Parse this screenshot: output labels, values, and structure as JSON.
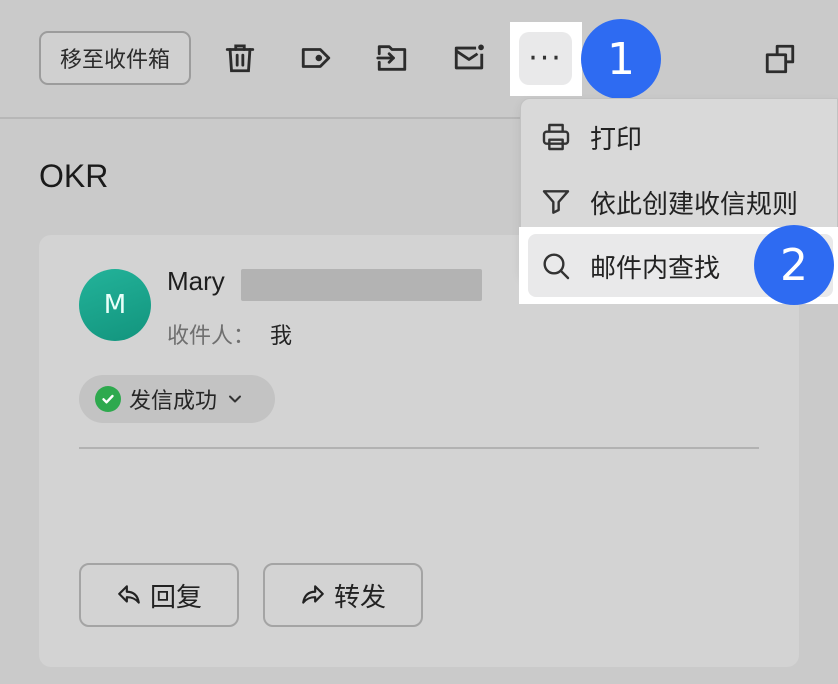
{
  "toolbar": {
    "move_to_inbox_label": "移至收件箱",
    "icons": [
      "trash-icon",
      "tag-icon",
      "move-icon",
      "mail-unread-icon"
    ],
    "more_label": "···",
    "window_icon": "window-icon"
  },
  "annotations": {
    "step1": "1",
    "step2": "2"
  },
  "mail": {
    "subject": "OKR",
    "avatar_letter": "M",
    "sender_name": "Mary",
    "to_label": "收件人：",
    "to_value": "我",
    "status_label": "发信成功"
  },
  "actions": {
    "reply_label": "回复",
    "forward_label": "转发"
  },
  "menu": {
    "items": [
      {
        "label": "打印",
        "icon": "printer-icon"
      },
      {
        "label": "依此创建收信规则",
        "icon": "filter-icon"
      },
      {
        "label": "邮件内查找",
        "icon": "search-icon"
      }
    ]
  },
  "colors": {
    "badge": "#2e6bf2",
    "status_ok": "#2ea94e",
    "avatar": "#1aa38b"
  }
}
